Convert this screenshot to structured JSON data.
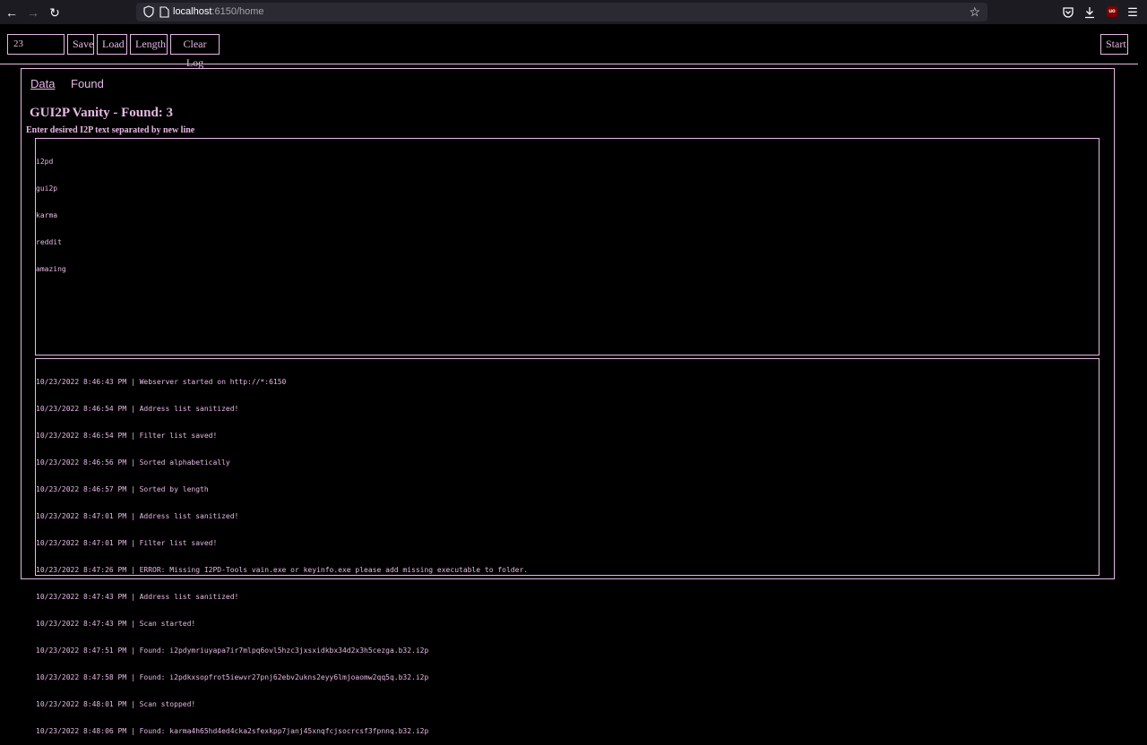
{
  "browser": {
    "url_host": "localhost",
    "url_rest": ":6150/home",
    "ublock_badge": "uo"
  },
  "toolbar": {
    "length_value": "23",
    "save_label": "Save",
    "load_label": "Load",
    "length_label": "Length",
    "clear_log_label": "Clear Log",
    "start_label": "Start"
  },
  "tabs": [
    {
      "label": "Data",
      "active": true
    },
    {
      "label": "Found",
      "active": false
    }
  ],
  "main": {
    "title": "GUI2P Vanity - Found: 3",
    "input_label": "Enter desired I2P text separated by new line",
    "input_lines": [
      "i2pd",
      "gui2p",
      "karma",
      "reddit",
      "amazing"
    ]
  },
  "log": [
    "10/23/2022 8:46:43 PM | Webserver started on http://*:6150",
    "10/23/2022 8:46:54 PM | Address list sanitized!",
    "10/23/2022 8:46:54 PM | Filter list saved!",
    "10/23/2022 8:46:56 PM | Sorted alphabetically",
    "10/23/2022 8:46:57 PM | Sorted by length",
    "10/23/2022 8:47:01 PM | Address list sanitized!",
    "10/23/2022 8:47:01 PM | Filter list saved!",
    "10/23/2022 8:47:26 PM | ERROR: Missing I2PD-Tools vain.exe or keyinfo.exe please add missing executable to folder.",
    "10/23/2022 8:47:43 PM | Address list sanitized!",
    "10/23/2022 8:47:43 PM | Scan started!",
    "10/23/2022 8:47:51 PM | Found: i2pdymriuyapa7ir7mlpq6ovl5hzc3jxsxidkbx34d2x3h5cezga.b32.i2p",
    "10/23/2022 8:47:58 PM | Found: i2pdkxsopfrot5iewvr27pnj62ebv2ukns2eyy6lmjoaomw2qq5q.b32.i2p",
    "10/23/2022 8:48:01 PM | Scan stopped!",
    "10/23/2022 8:48:06 PM | Found: karma4h65hd4ed4cka2sfexkpp7janj45xnqfcjsocrcsf3fpnnq.b32.i2p"
  ]
}
